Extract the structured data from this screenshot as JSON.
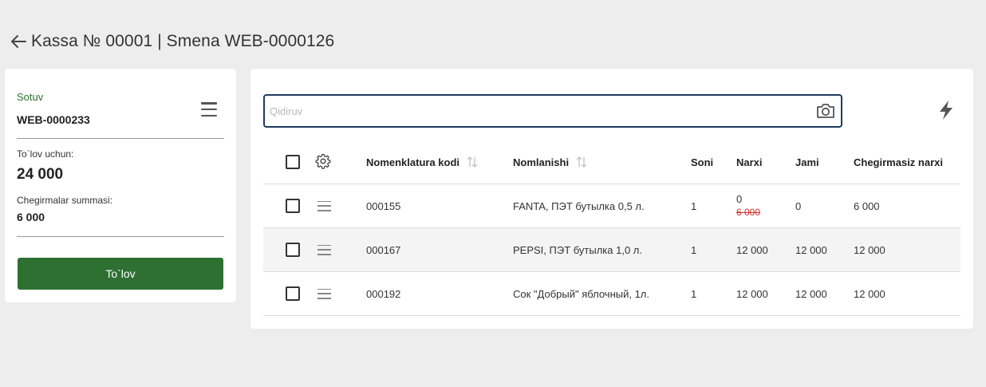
{
  "header": {
    "title": "Kassa № 00001 | Smena WEB-0000126",
    "back_icon": "arrow-left-icon"
  },
  "sale": {
    "label": "Sotuv",
    "id": "WEB-0000233",
    "menu_icon": "hamburger-menu-icon",
    "to_pay_label": "To`lov uchun:",
    "to_pay_amount": "24 000",
    "discount_label": "Chegirmalar summasi:",
    "discount_amount": "6 000",
    "pay_button_label": "To`lov"
  },
  "search": {
    "placeholder": "Qidiruv",
    "value": "",
    "camera_icon": "camera-icon",
    "flash_icon": "lightning-icon"
  },
  "table": {
    "columns": {
      "code": "Nomenklatura kodi",
      "name": "Nomlanishi",
      "qty": "Soni",
      "price": "Narxi",
      "total": "Jami",
      "nodisc": "Chegirmasiz narxi"
    },
    "settings_icon": "gear-icon",
    "rows": [
      {
        "code": "000155",
        "name": "FANTA, ПЭТ бутылка 0,5 л.",
        "qty": "1",
        "price": "0",
        "old_price": "6 000",
        "total": "0",
        "nodisc": "6 000"
      },
      {
        "code": "000167",
        "name": "PEPSI, ПЭТ бутылка 1,0 л.",
        "qty": "1",
        "price": "12 000",
        "old_price": "",
        "total": "12 000",
        "nodisc": "12 000"
      },
      {
        "code": "000192",
        "name": "Сок \"Добрый\" яблочный, 1л.",
        "qty": "1",
        "price": "12 000",
        "old_price": "",
        "total": "12 000",
        "nodisc": "12 000"
      }
    ]
  },
  "colors": {
    "accent_green": "#2e7032",
    "search_border": "#1f3a5f",
    "strike_red": "#d32f2f"
  }
}
